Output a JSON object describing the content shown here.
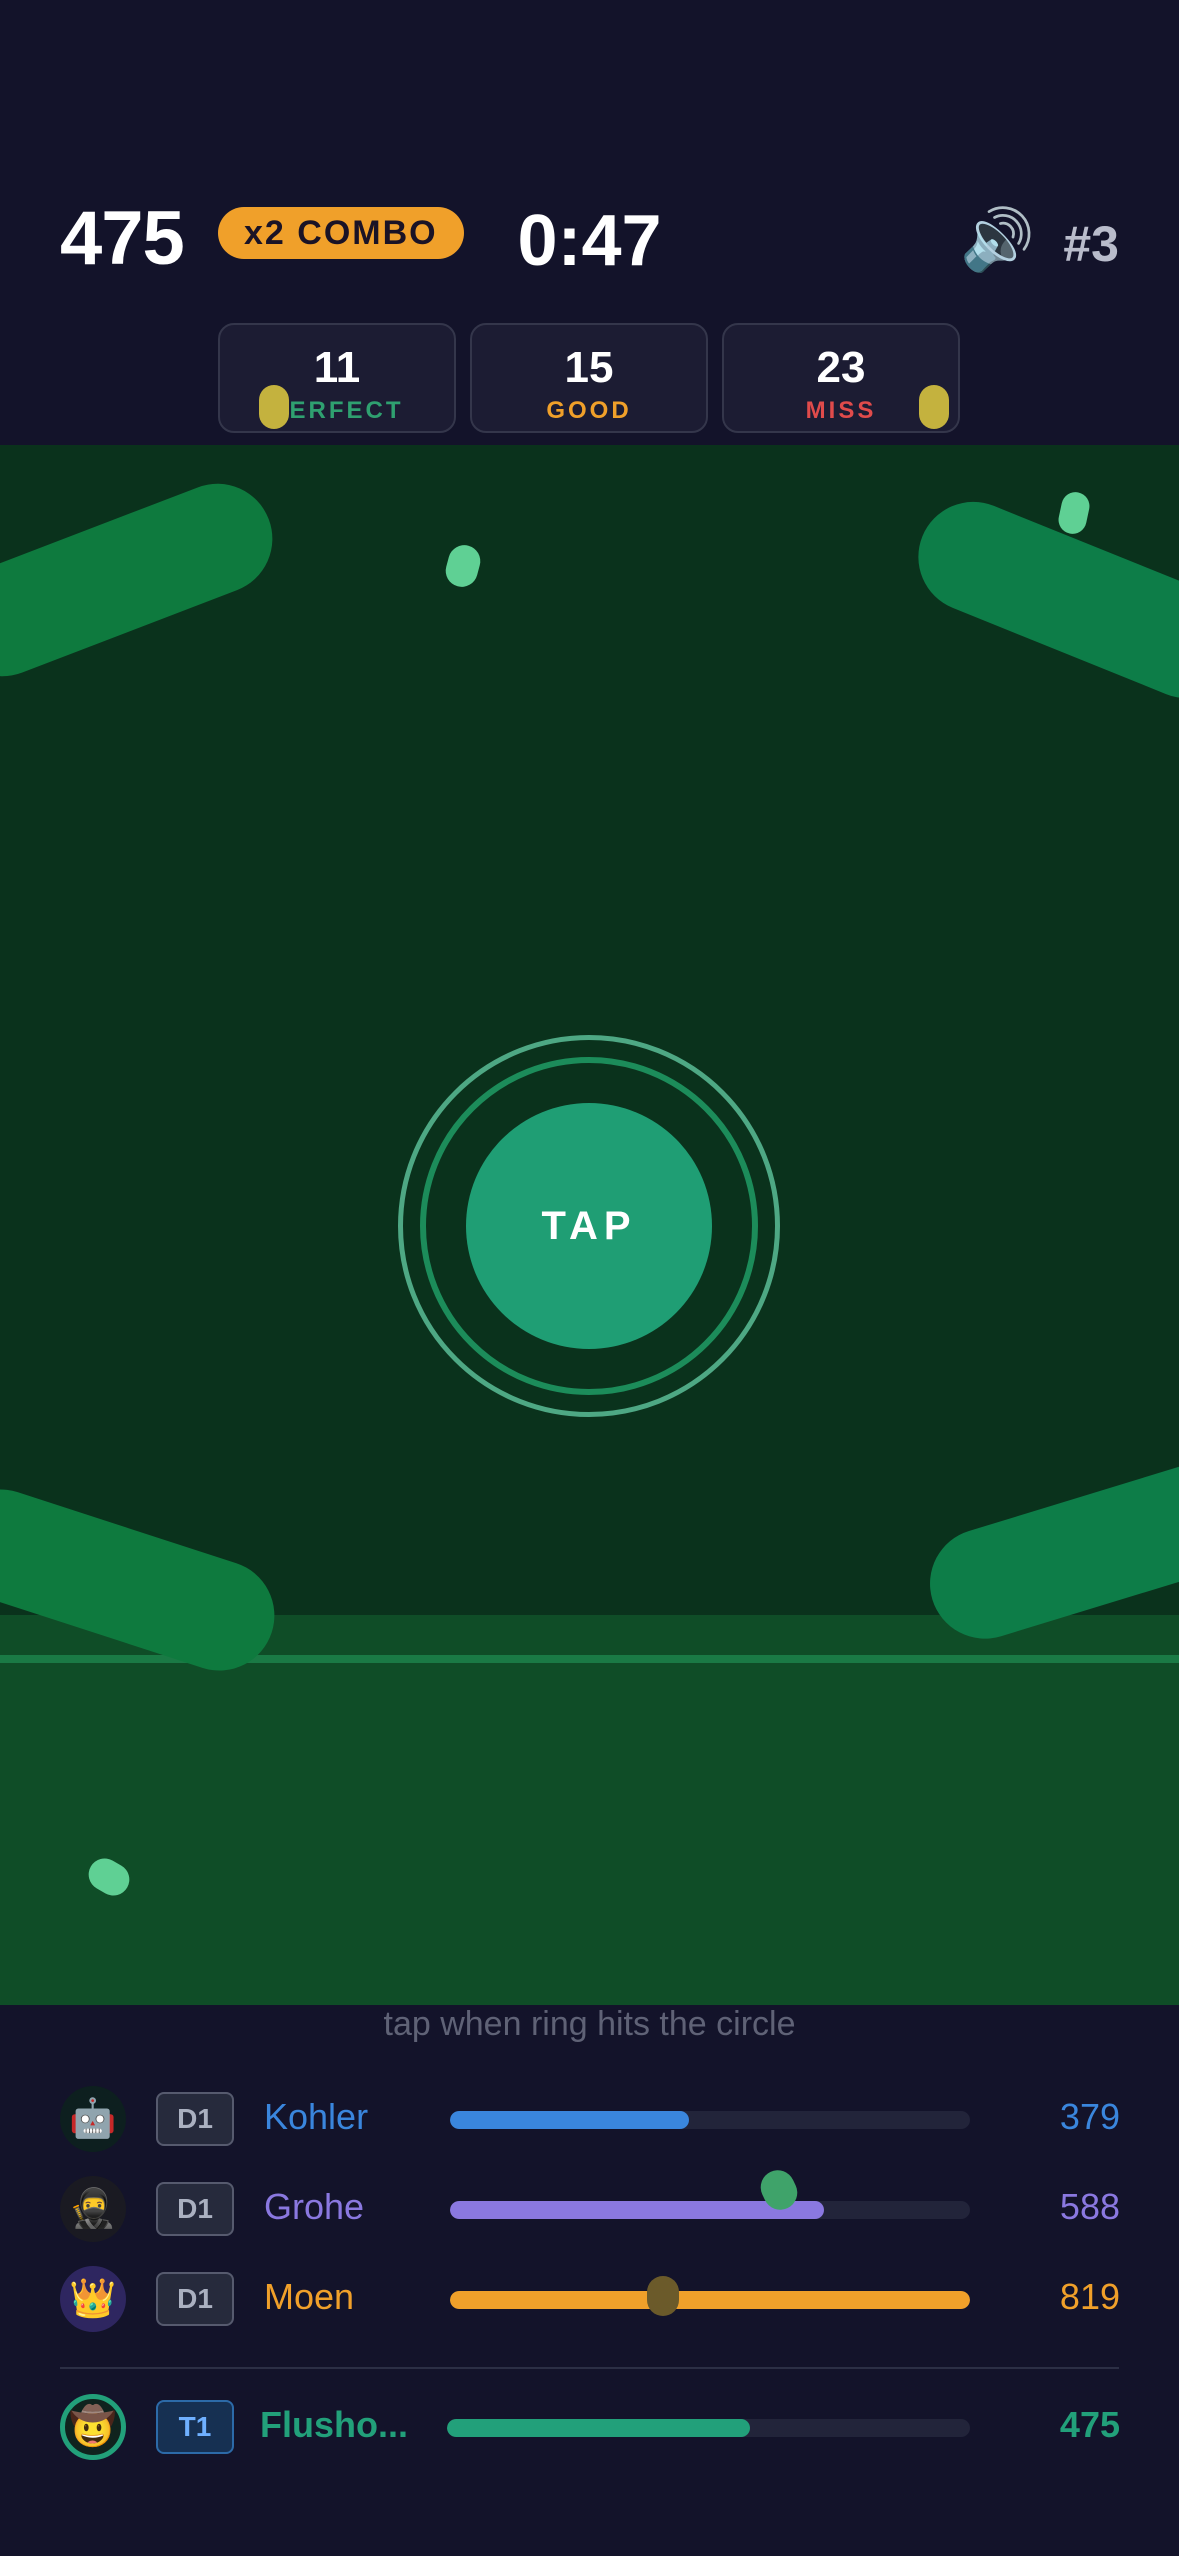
{
  "hud": {
    "score": "475",
    "combo": "x2 COMBO",
    "timer": "0:47",
    "sound_icon": "🔊",
    "rank": "#3"
  },
  "stats": [
    {
      "value": "11",
      "label": "PERFECT",
      "color": "#2fa070"
    },
    {
      "value": "15",
      "label": "GOOD",
      "color": "#f0a02a"
    },
    {
      "value": "23",
      "label": "MISS",
      "color": "#e04b4b"
    }
  ],
  "field": {
    "button_label": "TAP",
    "hint": "tap when ring hits the circle"
  },
  "leaderboard": [
    {
      "avatar": "🤖",
      "avatar_bg": "#0d1f1f",
      "tier": "D1",
      "name": "Kohler",
      "score": "379",
      "progress": 0.46,
      "color": "#3a86dd"
    },
    {
      "avatar": "🥷",
      "avatar_bg": "#1a1a22",
      "tier": "D1",
      "name": "Grohe",
      "score": "588",
      "progress": 0.72,
      "color": "#8a78e0"
    },
    {
      "avatar": "👑",
      "avatar_bg": "#2e2660",
      "tier": "D1",
      "name": "Moen",
      "score": "819",
      "progress": 1.0,
      "color": "#f0a02a"
    }
  ],
  "player": {
    "avatar": "🤠",
    "tier": "T1",
    "name": "Flusho...",
    "score": "475",
    "progress": 0.58,
    "color": "#22a07a"
  }
}
